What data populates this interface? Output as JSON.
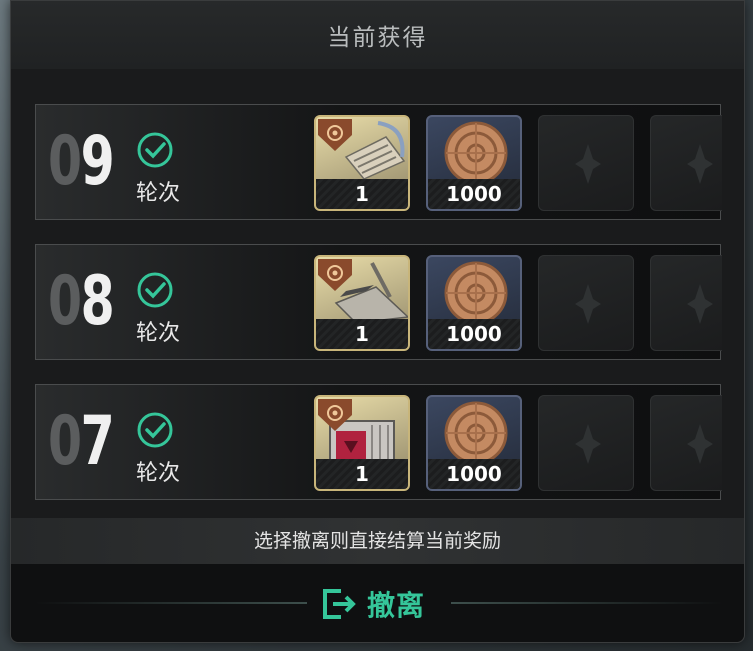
{
  "header": {
    "title": "当前获得"
  },
  "rounds": [
    {
      "number_dim": "0",
      "number_bright": "9",
      "label": "轮次",
      "items": [
        {
          "kind": "ticket",
          "count": "1"
        },
        {
          "kind": "coin",
          "count": "1000"
        }
      ]
    },
    {
      "number_dim": "0",
      "number_bright": "8",
      "label": "轮次",
      "items": [
        {
          "kind": "blade",
          "count": "1"
        },
        {
          "kind": "coin",
          "count": "1000"
        }
      ]
    },
    {
      "number_dim": "0",
      "number_bright": "7",
      "label": "轮次",
      "items": [
        {
          "kind": "crate",
          "count": "1"
        },
        {
          "kind": "coin",
          "count": "1000"
        }
      ]
    }
  ],
  "notice": "选择撤离则直接结算当前奖励",
  "evacuate": {
    "label": "撤离",
    "icon": "exit-icon",
    "color": "#35c69a"
  },
  "colors": {
    "accent": "#35c69a",
    "badge": "#8a4a2c"
  }
}
